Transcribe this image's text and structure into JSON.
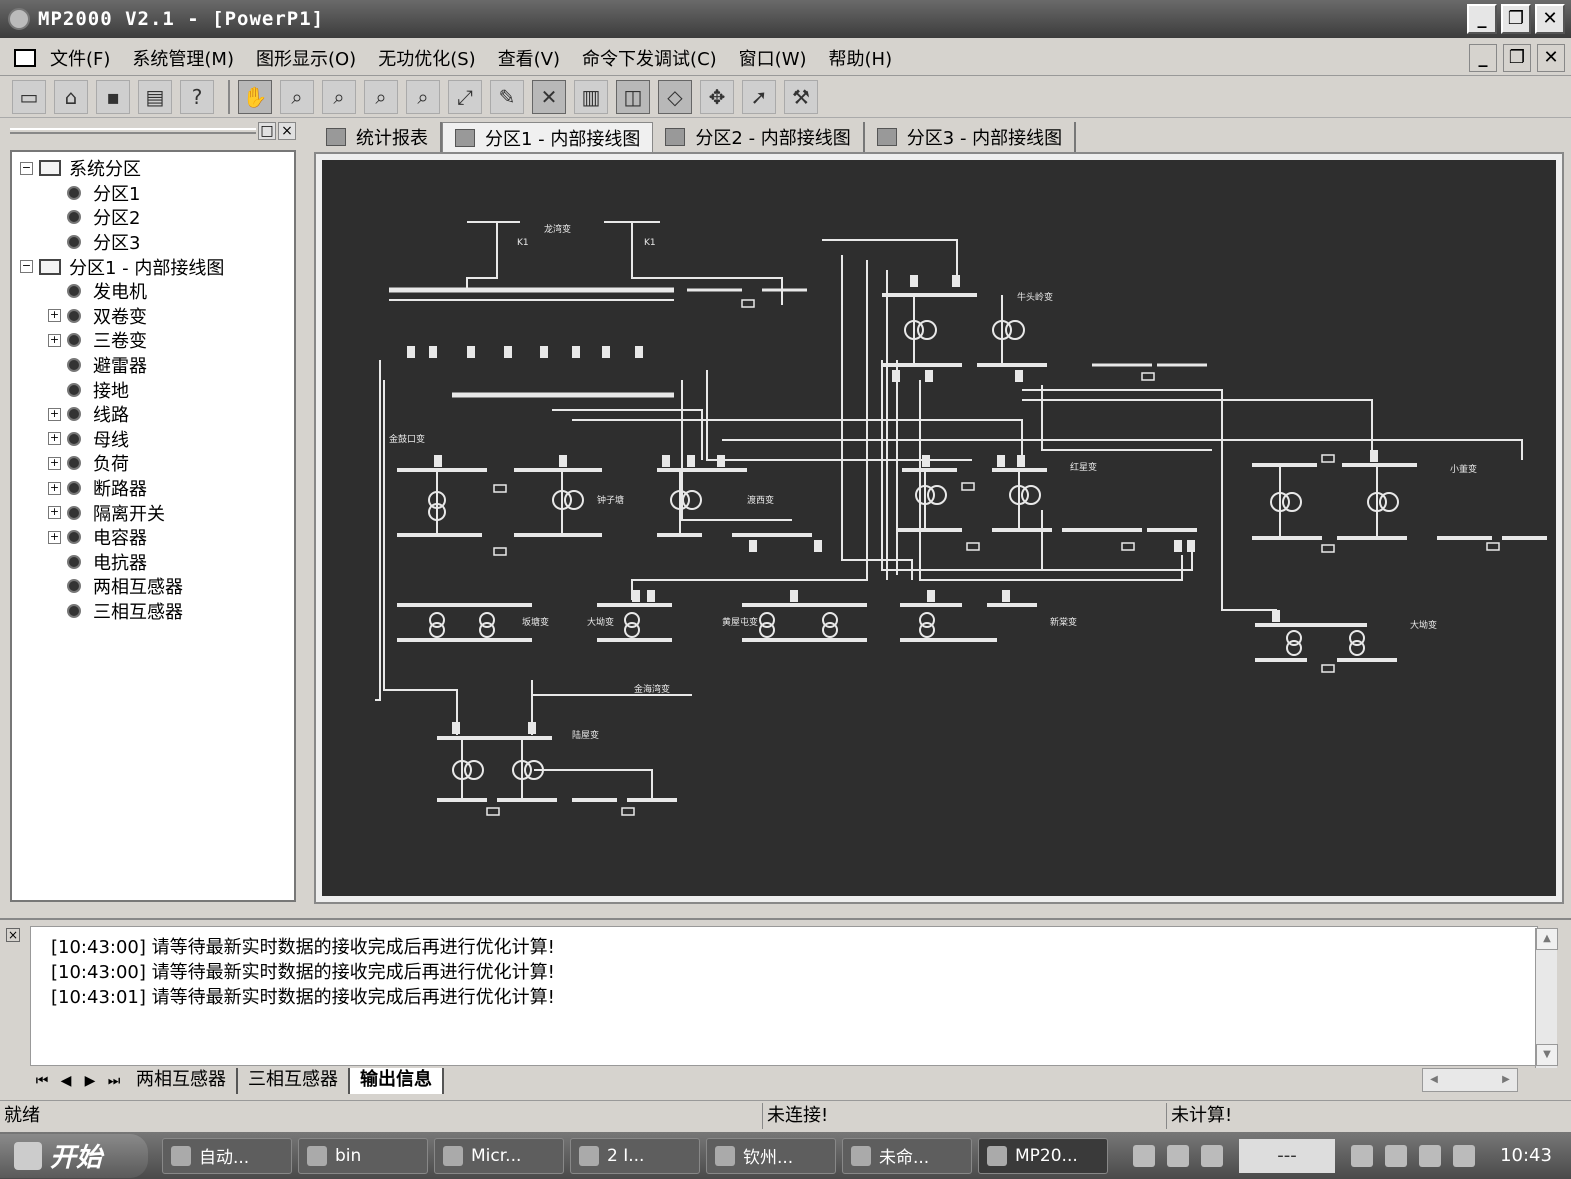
{
  "window": {
    "title": "MP2000 V2.1 - [PowerP1]",
    "controls": [
      "_",
      "❐",
      "✕"
    ]
  },
  "menu": {
    "items": [
      "文件(F)",
      "系统管理(M)",
      "图形显示(O)",
      "无功优化(S)",
      "查看(V)",
      "命令下发调试(C)",
      "窗口(W)",
      "帮助(H)"
    ],
    "mdi_controls": [
      "_",
      "❐",
      "✕"
    ]
  },
  "toolbar": {
    "buttons": [
      "new-icon",
      "open-icon",
      "save-icon",
      "print-icon",
      "help-icon",
      "pan-hand-icon",
      "zoom-in-icon",
      "zoom-out-icon",
      "zoom-window-icon",
      "zoom-all-icon",
      "fit-icon",
      "edit-icon",
      "tools-icon",
      "book-icon",
      "layer-icon",
      "diamond-icon",
      "move-icon",
      "pointer-icon",
      "connect-icon"
    ]
  },
  "tree": {
    "items": [
      {
        "label": "系统分区",
        "level": 0,
        "kind": "folder",
        "expander": "−"
      },
      {
        "label": "分区1",
        "level": 1,
        "kind": "leaf",
        "expander": ""
      },
      {
        "label": "分区2",
        "level": 1,
        "kind": "leaf",
        "expander": ""
      },
      {
        "label": "分区3",
        "level": 1,
        "kind": "leaf",
        "expander": ""
      },
      {
        "label": "分区1 - 内部接线图",
        "level": 0,
        "kind": "folder",
        "expander": "−"
      },
      {
        "label": "发电机",
        "level": 1,
        "kind": "leaf",
        "expander": ""
      },
      {
        "label": "双卷变",
        "level": 1,
        "kind": "leaf",
        "expander": "+"
      },
      {
        "label": "三卷变",
        "level": 1,
        "kind": "leaf",
        "expander": "+"
      },
      {
        "label": "避雷器",
        "level": 1,
        "kind": "leaf",
        "expander": ""
      },
      {
        "label": "接地",
        "level": 1,
        "kind": "leaf",
        "expander": ""
      },
      {
        "label": "线路",
        "level": 1,
        "kind": "leaf",
        "expander": "+"
      },
      {
        "label": "母线",
        "level": 1,
        "kind": "leaf",
        "expander": "+"
      },
      {
        "label": "负荷",
        "level": 1,
        "kind": "leaf",
        "expander": "+"
      },
      {
        "label": "断路器",
        "level": 1,
        "kind": "leaf",
        "expander": "+"
      },
      {
        "label": "隔离开关",
        "level": 1,
        "kind": "leaf",
        "expander": "+"
      },
      {
        "label": "电容器",
        "level": 1,
        "kind": "leaf",
        "expander": "+"
      },
      {
        "label": "电抗器",
        "level": 1,
        "kind": "leaf",
        "expander": ""
      },
      {
        "label": "两相互感器",
        "level": 1,
        "kind": "leaf",
        "expander": ""
      },
      {
        "label": "三相互感器",
        "level": 1,
        "kind": "leaf",
        "expander": ""
      }
    ]
  },
  "doc_tabs": [
    {
      "label": "统计报表",
      "active": false
    },
    {
      "label": "分区1 - 内部接线图",
      "active": true
    },
    {
      "label": "分区2 - 内部接线图",
      "active": false
    },
    {
      "label": "分区3 - 内部接线图",
      "active": false
    }
  ],
  "diagram": {
    "station_labels": [
      "龙湾变",
      "牛头岭变",
      "金鼓口变",
      "钟子塘",
      "渡西变",
      "红星变",
      "小董变",
      "坂塘变",
      "大坳变",
      "黄屋屯变",
      "新棠变",
      "金海湾变",
      "陆屋变"
    ],
    "breaker_code": "K1"
  },
  "output": {
    "lines": [
      "[10:43:00] 请等待最新实时数据的接收完成后再进行优化计算!",
      "[10:43:00] 请等待最新实时数据的接收完成后再进行优化计算!",
      "[10:43:01] 请等待最新实时数据的接收完成后再进行优化计算!"
    ],
    "tabs": [
      {
        "label": "两相互感器",
        "active": false
      },
      {
        "label": "三相互感器",
        "active": false
      },
      {
        "label": "输出信息",
        "active": true
      }
    ],
    "nav": [
      "⏮",
      "◀",
      "▶",
      "⏭"
    ]
  },
  "status": {
    "ready": "就绪",
    "connection": "未连接!",
    "calc": "未计算!"
  },
  "taskbar": {
    "start": "开始",
    "tasks": [
      {
        "label": "自动..."
      },
      {
        "label": "bin"
      },
      {
        "label": "Micr..."
      },
      {
        "label": "2 I..."
      },
      {
        "label": "钦州..."
      },
      {
        "label": "未命..."
      },
      {
        "label": "MP20..."
      }
    ],
    "input_box": "---",
    "clock": "10:43"
  }
}
